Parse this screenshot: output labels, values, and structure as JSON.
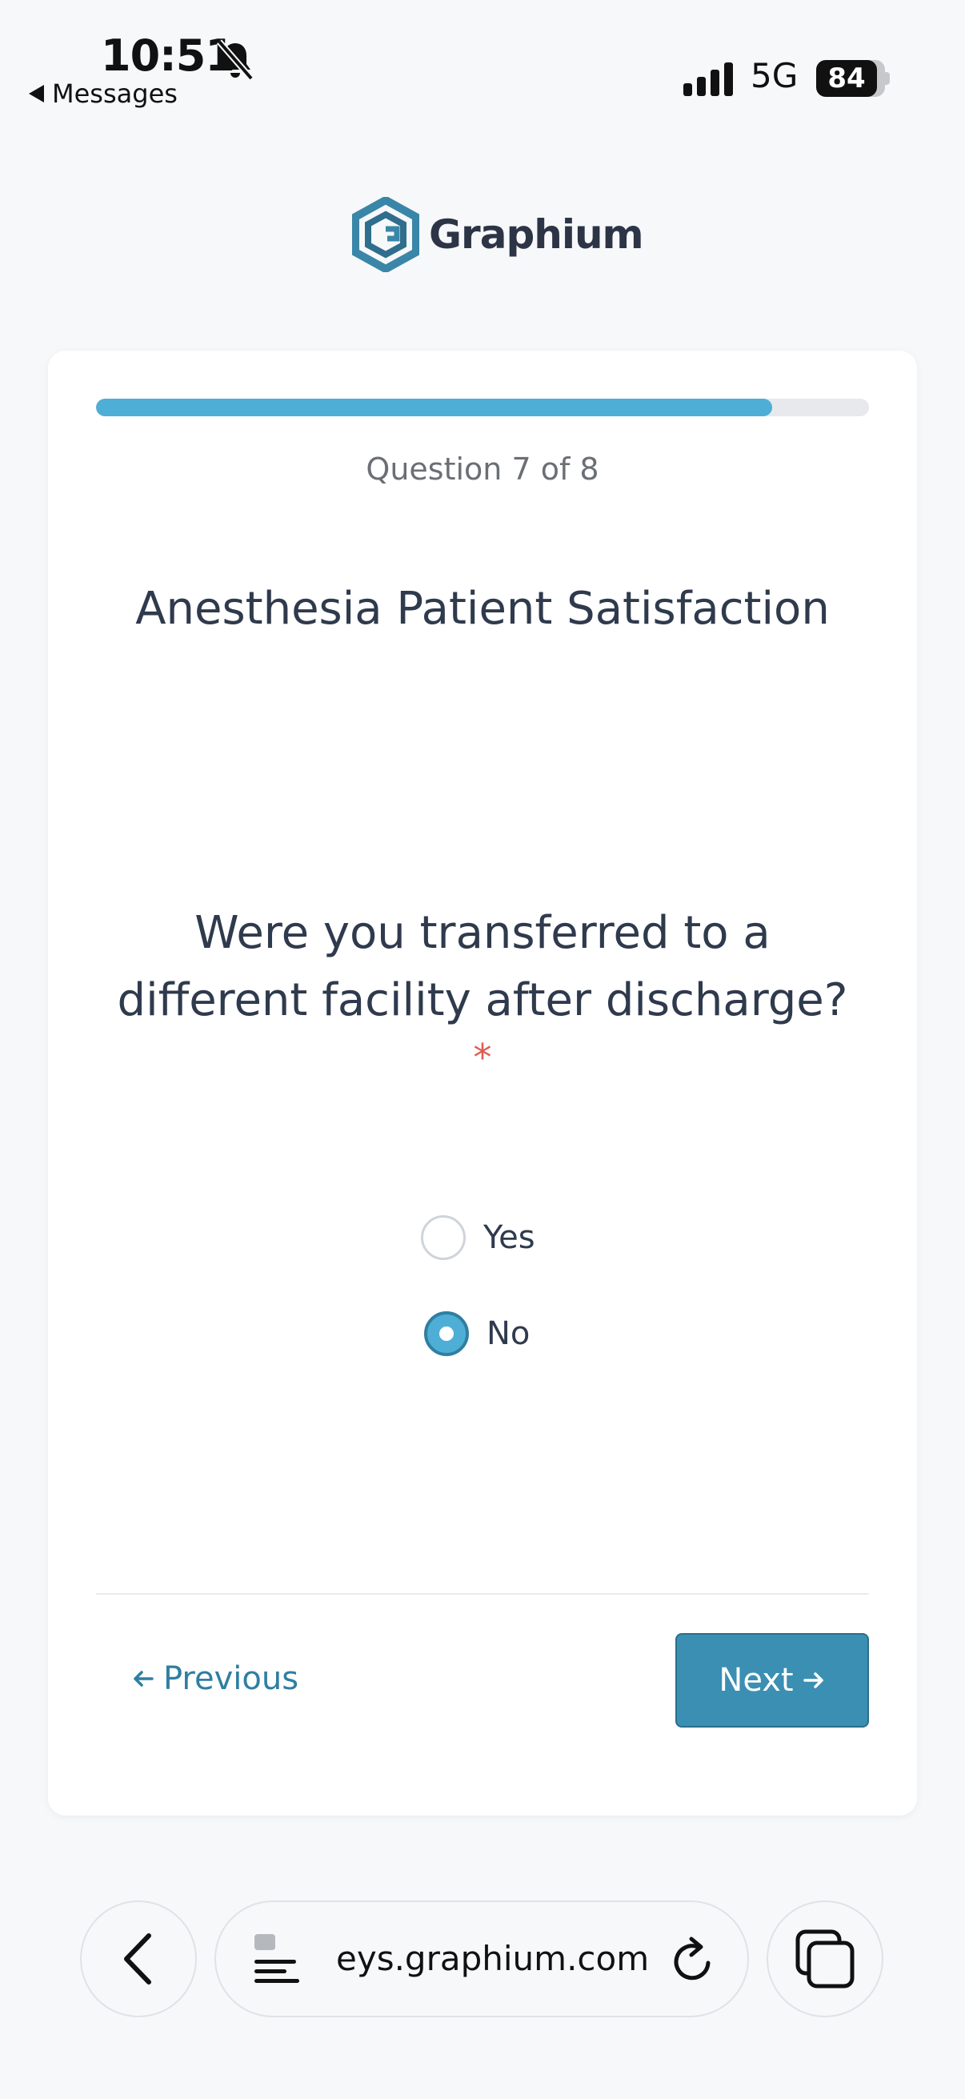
{
  "status_bar": {
    "time": "10:51",
    "back_app": "Messages",
    "network": "5G",
    "battery": "84"
  },
  "brand": {
    "name": "Graphium",
    "color": "#3a86a8"
  },
  "survey": {
    "progress_percent": 87.5,
    "question_counter": "Question 7 of 8",
    "title": "Anesthesia Patient Satisfaction",
    "question": "Were you transferred to a different facility after discharge?",
    "required_marker": "*",
    "options": [
      {
        "label": "Yes",
        "selected": false
      },
      {
        "label": "No",
        "selected": true
      }
    ],
    "previous_label": "Previous",
    "next_label": "Next",
    "accent_color": "#3b8fb2"
  },
  "browser": {
    "url": "eys.graphium.com"
  }
}
